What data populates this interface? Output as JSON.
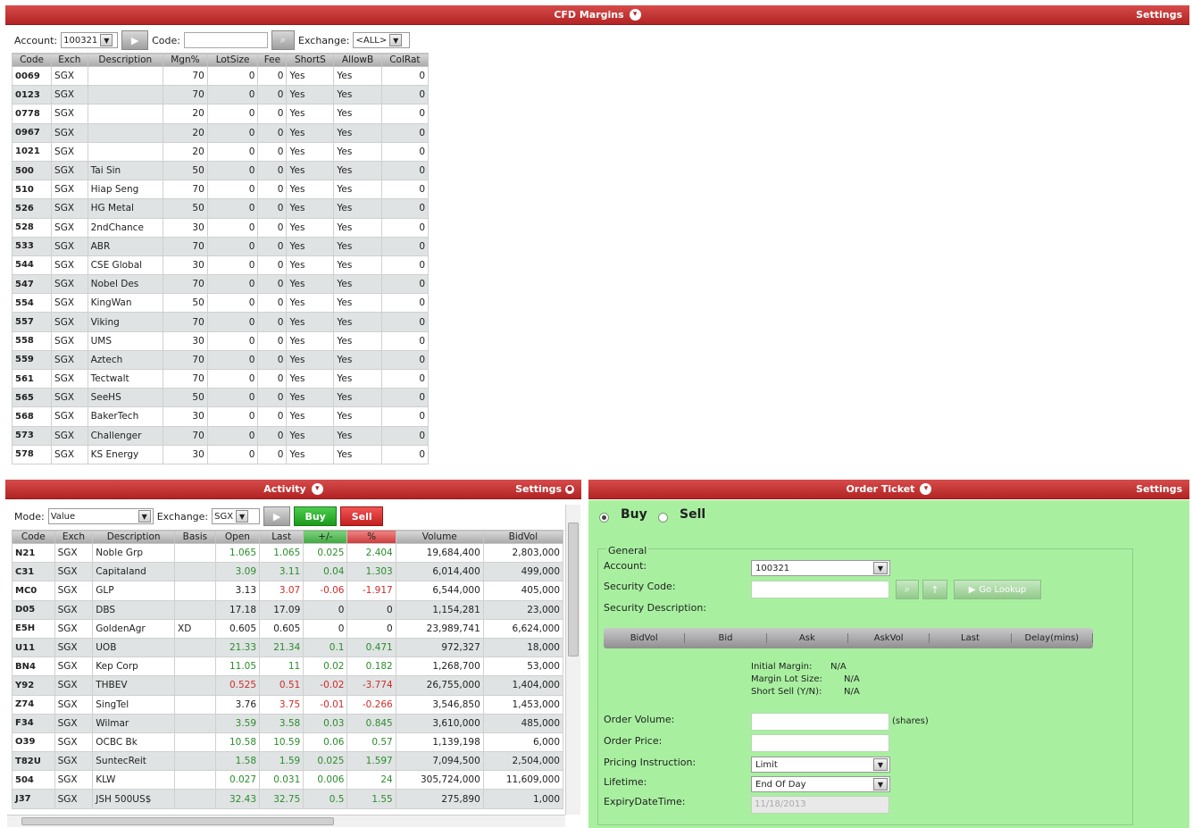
{
  "cfd": {
    "title": "CFD Margins",
    "settings": "Settings",
    "account_label": "Account:",
    "account_value": "100321",
    "code_label": "Code:",
    "exchange_label": "Exchange:",
    "exchange_value": "<ALL>",
    "columns": [
      "Code",
      "Exch",
      "Description",
      "Mgn%",
      "LotSize",
      "Fee",
      "ShortS",
      "AllowB",
      "ColRat"
    ],
    "rows": [
      [
        "0069",
        "SGX",
        "",
        "70",
        "0",
        "0",
        "Yes",
        "Yes",
        "0"
      ],
      [
        "0123",
        "SGX",
        "",
        "70",
        "0",
        "0",
        "Yes",
        "Yes",
        "0"
      ],
      [
        "0778",
        "SGX",
        "",
        "20",
        "0",
        "0",
        "Yes",
        "Yes",
        "0"
      ],
      [
        "0967",
        "SGX",
        "",
        "20",
        "0",
        "0",
        "Yes",
        "Yes",
        "0"
      ],
      [
        "1021",
        "SGX",
        "",
        "20",
        "0",
        "0",
        "Yes",
        "Yes",
        "0"
      ],
      [
        "500",
        "SGX",
        "Tai Sin",
        "50",
        "0",
        "0",
        "Yes",
        "Yes",
        "0"
      ],
      [
        "510",
        "SGX",
        "Hiap Seng",
        "70",
        "0",
        "0",
        "Yes",
        "Yes",
        "0"
      ],
      [
        "526",
        "SGX",
        "HG Metal",
        "50",
        "0",
        "0",
        "Yes",
        "Yes",
        "0"
      ],
      [
        "528",
        "SGX",
        "2ndChance",
        "30",
        "0",
        "0",
        "Yes",
        "Yes",
        "0"
      ],
      [
        "533",
        "SGX",
        "ABR",
        "70",
        "0",
        "0",
        "Yes",
        "Yes",
        "0"
      ],
      [
        "544",
        "SGX",
        "CSE Global",
        "30",
        "0",
        "0",
        "Yes",
        "Yes",
        "0"
      ],
      [
        "547",
        "SGX",
        "Nobel Des",
        "70",
        "0",
        "0",
        "Yes",
        "Yes",
        "0"
      ],
      [
        "554",
        "SGX",
        "KingWan",
        "50",
        "0",
        "0",
        "Yes",
        "Yes",
        "0"
      ],
      [
        "557",
        "SGX",
        "Viking",
        "70",
        "0",
        "0",
        "Yes",
        "Yes",
        "0"
      ],
      [
        "558",
        "SGX",
        "UMS",
        "30",
        "0",
        "0",
        "Yes",
        "Yes",
        "0"
      ],
      [
        "559",
        "SGX",
        "Aztech",
        "70",
        "0",
        "0",
        "Yes",
        "Yes",
        "0"
      ],
      [
        "561",
        "SGX",
        "Tectwalt",
        "70",
        "0",
        "0",
        "Yes",
        "Yes",
        "0"
      ],
      [
        "565",
        "SGX",
        "SeeHS",
        "50",
        "0",
        "0",
        "Yes",
        "Yes",
        "0"
      ],
      [
        "568",
        "SGX",
        "BakerTech",
        "30",
        "0",
        "0",
        "Yes",
        "Yes",
        "0"
      ],
      [
        "573",
        "SGX",
        "Challenger",
        "70",
        "0",
        "0",
        "Yes",
        "Yes",
        "0"
      ],
      [
        "578",
        "SGX",
        "KS Energy",
        "30",
        "0",
        "0",
        "Yes",
        "Yes",
        "0"
      ]
    ]
  },
  "activity": {
    "title": "Activity",
    "settings": "Settings",
    "mode_label": "Mode:",
    "mode_value": "Value",
    "exchange_label": "Exchange:",
    "exchange_value": "SGX",
    "buy_label": "Buy",
    "sell_label": "Sell",
    "columns": [
      "Code",
      "Exch",
      "Description",
      "Basis",
      "Open",
      "Last",
      "+/-",
      "%",
      "Volume",
      "BidVol"
    ],
    "rows": [
      {
        "c": [
          "N21",
          "SGX",
          "Noble Grp",
          "",
          "1.065",
          "1.065",
          "0.025",
          "2.404",
          "19,684,400",
          "2,803,000"
        ],
        "t": "g"
      },
      {
        "c": [
          "C31",
          "SGX",
          "Capitaland",
          "",
          "3.09",
          "3.11",
          "0.04",
          "1.303",
          "6,014,400",
          "499,000"
        ],
        "t": "g"
      },
      {
        "c": [
          "MC0",
          "SGX",
          "GLP",
          "",
          "3.13",
          "3.07",
          "-0.06",
          "-1.917",
          "6,544,000",
          "405,000"
        ],
        "t": "r"
      },
      {
        "c": [
          "D05",
          "SGX",
          "DBS",
          "",
          "17.18",
          "17.09",
          "0",
          "0",
          "1,154,281",
          "23,000"
        ],
        "t": "n"
      },
      {
        "c": [
          "E5H",
          "SGX",
          "GoldenAgr",
          "XD",
          "0.605",
          "0.605",
          "0",
          "0",
          "23,989,741",
          "6,624,000"
        ],
        "t": "n"
      },
      {
        "c": [
          "U11",
          "SGX",
          "UOB",
          "",
          "21.33",
          "21.34",
          "0.1",
          "0.471",
          "972,327",
          "18,000"
        ],
        "t": "g"
      },
      {
        "c": [
          "BN4",
          "SGX",
          "Kep Corp",
          "",
          "11.05",
          "11",
          "0.02",
          "0.182",
          "1,268,700",
          "53,000"
        ],
        "t": "g"
      },
      {
        "c": [
          "Y92",
          "SGX",
          "THBEV",
          "",
          "0.525",
          "0.51",
          "-0.02",
          "-3.774",
          "26,755,000",
          "1,404,000"
        ],
        "t": "r"
      },
      {
        "c": [
          "Z74",
          "SGX",
          "SingTel",
          "",
          "3.76",
          "3.75",
          "-0.01",
          "-0.266",
          "3,546,850",
          "1,453,000"
        ],
        "t": "r"
      },
      {
        "c": [
          "F34",
          "SGX",
          "Wilmar",
          "",
          "3.59",
          "3.58",
          "0.03",
          "0.845",
          "3,610,000",
          "485,000"
        ],
        "t": "g"
      },
      {
        "c": [
          "O39",
          "SGX",
          "OCBC Bk",
          "",
          "10.58",
          "10.59",
          "0.06",
          "0.57",
          "1,139,198",
          "6,000"
        ],
        "t": "g"
      },
      {
        "c": [
          "T82U",
          "SGX",
          "SuntecReit",
          "",
          "1.58",
          "1.59",
          "0.025",
          "1.597",
          "7,094,500",
          "2,504,000"
        ],
        "t": "g"
      },
      {
        "c": [
          "504",
          "SGX",
          "KLW",
          "",
          "0.027",
          "0.031",
          "0.006",
          "24",
          "305,724,000",
          "11,609,000"
        ],
        "t": "g"
      },
      {
        "c": [
          "J37",
          "SGX",
          "JSH 500US$",
          "",
          "32.43",
          "32.75",
          "0.5",
          "1.55",
          "275,890",
          "1,000"
        ],
        "t": "g"
      }
    ]
  },
  "order": {
    "title": "Order Ticket",
    "settings": "Settings",
    "buy": "Buy",
    "sell": "Sell",
    "general": "General",
    "account_label": "Account:",
    "account_value": "100321",
    "security_code_label": "Security Code:",
    "security_desc_label": "Security Description:",
    "go_label": "Go Lookup",
    "quote_columns": [
      "BidVol",
      "Bid",
      "Ask",
      "AskVol",
      "Last",
      "Delay(mins)"
    ],
    "initial_margin_label": "Initial Margin:",
    "initial_margin_value": "N/A",
    "margin_lot_label": "Margin Lot Size:",
    "margin_lot_value": "N/A",
    "short_sell_label": "Short Sell (Y/N):",
    "short_sell_value": "N/A",
    "order_volume_label": "Order Volume:",
    "shares_label": "(shares)",
    "order_price_label": "Order Price:",
    "pricing_label": "Pricing Instruction:",
    "pricing_value": "Limit",
    "lifetime_label": "Lifetime:",
    "lifetime_value": "End Of Day",
    "expiry_label": "ExpiryDateTime:",
    "expiry_value": "11/18/2013"
  },
  "colors": {
    "title_red": "#b32424",
    "order_green": "#a8f0a0",
    "up": "#2c8c2c",
    "down": "#d12b2b"
  }
}
